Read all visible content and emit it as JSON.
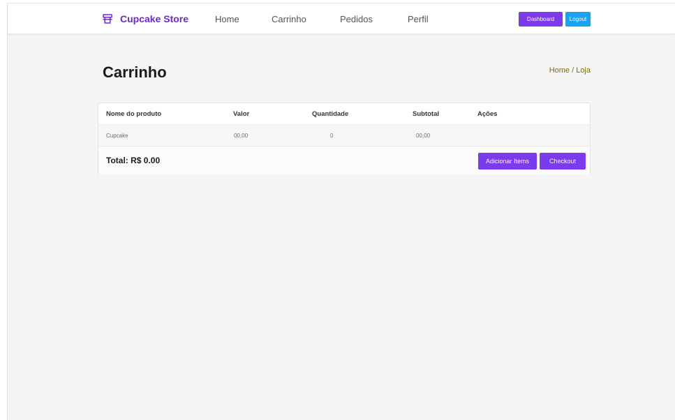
{
  "colors": {
    "brand": "#6d28d9",
    "primary_button": "#7c3aed",
    "logout_button": "#1aa3f0",
    "breadcrumb": "#7a6a12"
  },
  "navbar": {
    "brand_icon": "cupcake-icon",
    "brand_name": "Cupcake Store",
    "links": [
      "Home",
      "Carrinho",
      "Pedidos",
      "Perfil"
    ],
    "dashboard_label": "Dashboard",
    "logout_label": "Logout"
  },
  "page": {
    "title": "Carrinho",
    "breadcrumb": "Home / Loja"
  },
  "cart": {
    "columns": [
      "Nome do produto",
      "Valor",
      "Quantidade",
      "Subtotal",
      "Ações"
    ],
    "rows": [
      {
        "name": "Cupcake",
        "value": "00,00",
        "quantity": "0",
        "subtotal": "00,00",
        "actions": ""
      }
    ],
    "total": "Total: R$ 0.00",
    "add_items_label": "Adicionar Items",
    "checkout_label": "Checkout"
  }
}
